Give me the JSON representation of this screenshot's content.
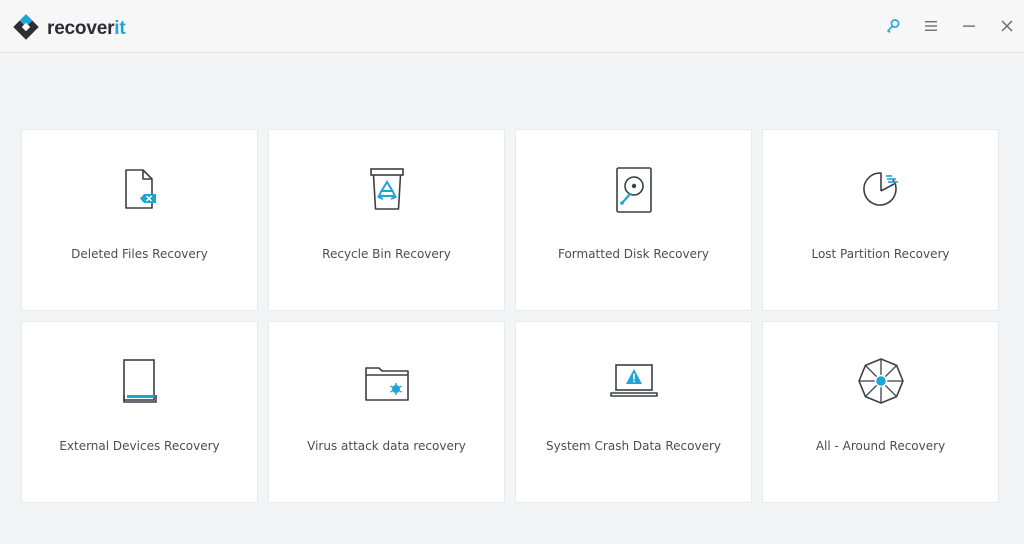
{
  "app": {
    "brand_main": "recover",
    "brand_accent": "it"
  },
  "colors": {
    "accent": "#1ea5d8",
    "icon_stroke": "#3c3f47",
    "background": "#f3f4f6",
    "card": "#ffffff"
  },
  "window_controls": {
    "icons": [
      "key-icon",
      "menu-icon",
      "minimize-icon",
      "close-icon"
    ]
  },
  "cards": [
    {
      "label": "Deleted Files Recovery",
      "icon": "deleted-file-icon"
    },
    {
      "label": "Recycle Bin Recovery",
      "icon": "recycle-bin-icon"
    },
    {
      "label": "Formatted Disk Recovery",
      "icon": "hard-disk-icon"
    },
    {
      "label": "Lost Partition Recovery",
      "icon": "partition-icon"
    },
    {
      "label": "External Devices Recovery",
      "icon": "external-device-icon"
    },
    {
      "label": "Virus attack data recovery",
      "icon": "virus-folder-icon"
    },
    {
      "label": "System Crash Data Recovery",
      "icon": "crashed-laptop-icon"
    },
    {
      "label": "All - Around Recovery",
      "icon": "all-around-icon"
    }
  ]
}
